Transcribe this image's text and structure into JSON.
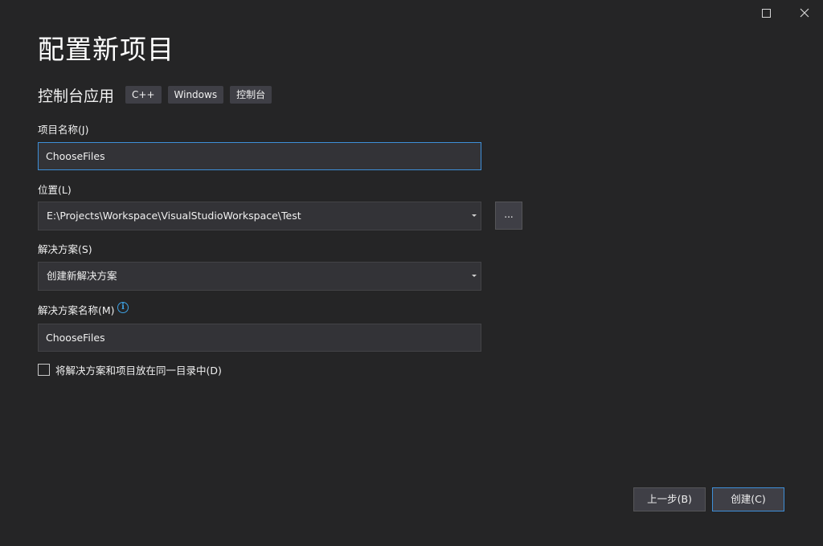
{
  "window": {
    "maximize_icon": "maximize-icon",
    "close_icon": "close-icon"
  },
  "title": "配置新项目",
  "template": {
    "name": "控制台应用",
    "tags": [
      "C++",
      "Windows",
      "控制台"
    ]
  },
  "fields": {
    "project_name": {
      "label": "项目名称(J)",
      "value": "ChooseFiles"
    },
    "location": {
      "label": "位置(L)",
      "value": "E:\\Projects\\Workspace\\VisualStudioWorkspace\\Test",
      "browse_label": "..."
    },
    "solution": {
      "label": "解决方案(S)",
      "value": "创建新解决方案"
    },
    "solution_name": {
      "label": "解决方案名称(M)",
      "value": "ChooseFiles",
      "info_icon": "info-icon"
    }
  },
  "same_directory": {
    "label": "将解决方案和项目放在同一目录中(D)",
    "checked": false
  },
  "buttons": {
    "back": "上一步(B)",
    "create": "创建(C)"
  },
  "colors": {
    "background": "#252526",
    "accent": "#3e8fd8",
    "info": "#3ea2e4"
  }
}
